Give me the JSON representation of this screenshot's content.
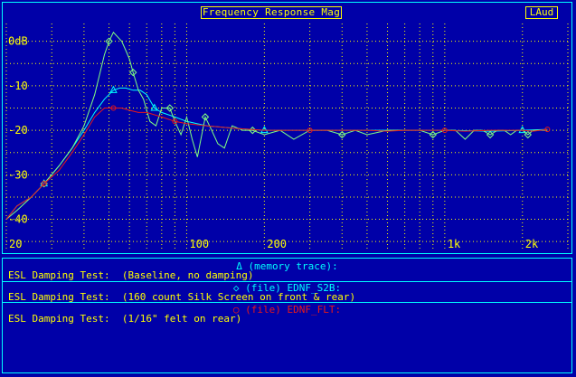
{
  "window": {
    "title": "Frequency Response Mag",
    "mode_label": "LAud"
  },
  "colors": {
    "background": "#0000a8",
    "grid": "#ffff00",
    "trace_memory": "#00ffff",
    "trace_s2b": "#80ff80",
    "trace_flt": "#e81818",
    "tick_label": "#ffff00"
  },
  "chart_data": {
    "type": "line",
    "title": "Frequency Response Mag",
    "x_scale": "log",
    "xlim": [
      20,
      3000
    ],
    "ylim": [
      -47,
      4
    ],
    "y_unit": "dB",
    "grid": true,
    "x_tick_labels": [
      {
        "value": 20,
        "label": "20"
      },
      {
        "value": 100,
        "label": "100"
      },
      {
        "value": 200,
        "label": "200"
      },
      {
        "value": 1000,
        "label": "1k"
      },
      {
        "value": 2000,
        "label": "2k"
      }
    ],
    "y_tick_labels": [
      {
        "value": 0,
        "label": "0dB"
      },
      {
        "value": -10,
        "label": "-10"
      },
      {
        "value": -20,
        "label": "-20"
      },
      {
        "value": -30,
        "label": "-30"
      },
      {
        "value": -40,
        "label": "-40"
      }
    ],
    "series": [
      {
        "name": "(memory trace):",
        "marker": "triangle",
        "x": [
          20,
          22,
          25,
          28,
          32,
          36,
          40,
          44,
          48,
          52,
          55,
          58,
          62,
          66,
          70,
          75,
          80,
          90,
          100,
          120,
          150,
          200,
          300,
          500,
          700,
          1000,
          1500,
          2000,
          2500
        ],
        "y": [
          -40,
          -37,
          -35,
          -32,
          -28,
          -24,
          -20,
          -16,
          -13,
          -11,
          -10.5,
          -10.5,
          -11,
          -11,
          -12,
          -15,
          -16,
          -17,
          -18,
          -19,
          -19.5,
          -20,
          -20,
          -20,
          -20,
          -20,
          -20.2,
          -20,
          -19.8
        ]
      },
      {
        "name": "(file) EDNF_S2B:",
        "marker": "diamond",
        "x": [
          20,
          22,
          25,
          28,
          32,
          36,
          40,
          44,
          48,
          50,
          52,
          54,
          56,
          58,
          60,
          62,
          65,
          68,
          72,
          76,
          80,
          86,
          90,
          95,
          100,
          105,
          110,
          118,
          125,
          132,
          140,
          150,
          165,
          180,
          200,
          230,
          260,
          300,
          350,
          400,
          450,
          500,
          600,
          700,
          800,
          900,
          1000,
          1100,
          1200,
          1300,
          1400,
          1500,
          1600,
          1700,
          1800,
          1900,
          2000,
          2100,
          2200,
          2300,
          2400,
          2500
        ],
        "y": [
          -40,
          -38,
          -35,
          -32,
          -28,
          -24,
          -19,
          -12,
          -3,
          0,
          2,
          1,
          0,
          -2,
          -4,
          -7,
          -11,
          -13,
          -18,
          -19,
          -15,
          -15,
          -18,
          -21,
          -17,
          -22,
          -26,
          -17,
          -20,
          -23,
          -24,
          -19,
          -20,
          -20,
          -21,
          -20,
          -22,
          -20,
          -20,
          -21,
          -20,
          -21,
          -20,
          -20,
          -20,
          -21,
          -20,
          -20,
          -22,
          -20,
          -20,
          -21,
          -20,
          -20,
          -21,
          -20,
          -20,
          -21,
          -20,
          -20,
          -20,
          -20
        ]
      },
      {
        "name": "(file) EDNF_FLT:",
        "marker": "circle",
        "x": [
          20,
          22,
          25,
          28,
          32,
          36,
          40,
          44,
          48,
          52,
          56,
          60,
          65,
          70,
          80,
          90,
          100,
          120,
          150,
          200,
          250,
          300,
          400,
          500,
          600,
          700,
          800,
          1000,
          1200,
          1500,
          1800,
          2000,
          2200,
          2500
        ],
        "y": [
          -40,
          -37,
          -35,
          -32,
          -29,
          -25,
          -21,
          -17,
          -15,
          -15,
          -15,
          -15.5,
          -16,
          -16,
          -17,
          -18,
          -18.5,
          -19,
          -19.5,
          -20,
          -20,
          -20,
          -20,
          -20,
          -20.2,
          -20,
          -20,
          -20,
          -20.2,
          -20,
          -20,
          -20,
          -20.2,
          -19.8
        ]
      }
    ]
  },
  "legend": {
    "entries": [
      {
        "header": "Δ (memory trace):",
        "desc": "ESL Damping Test:  (Baseline, no damping)"
      },
      {
        "header": "◇ (file) EDNF_S2B:",
        "desc": "ESL Damping Test:  (160 count Silk Screen on front & rear)"
      },
      {
        "header": "○ (file) EDNF_FLT:",
        "desc": "ESL Damping Test:  (1/16\" felt on rear)"
      }
    ]
  }
}
